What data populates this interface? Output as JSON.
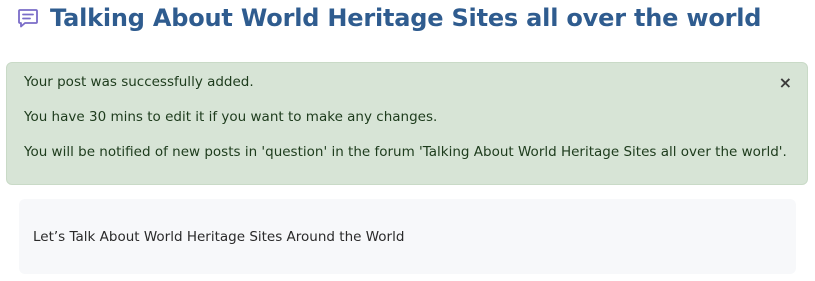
{
  "header": {
    "title": "Talking About World Heritage Sites all over the world",
    "icon": "discussion-icon",
    "title_color": "#2f5c8f",
    "icon_color": "#7a6cc8"
  },
  "alert": {
    "type": "success",
    "background": "#d7e4d6",
    "messages": [
      "Your post was successfully added.",
      "You have 30 mins to edit it if you want to make any changes.",
      "You will be notified of new posts in 'question' in the forum 'Talking About World Heritage Sites all over the world'."
    ],
    "close_label": "×"
  },
  "post": {
    "text": "Let’s Talk About World Heritage Sites Around the World"
  }
}
